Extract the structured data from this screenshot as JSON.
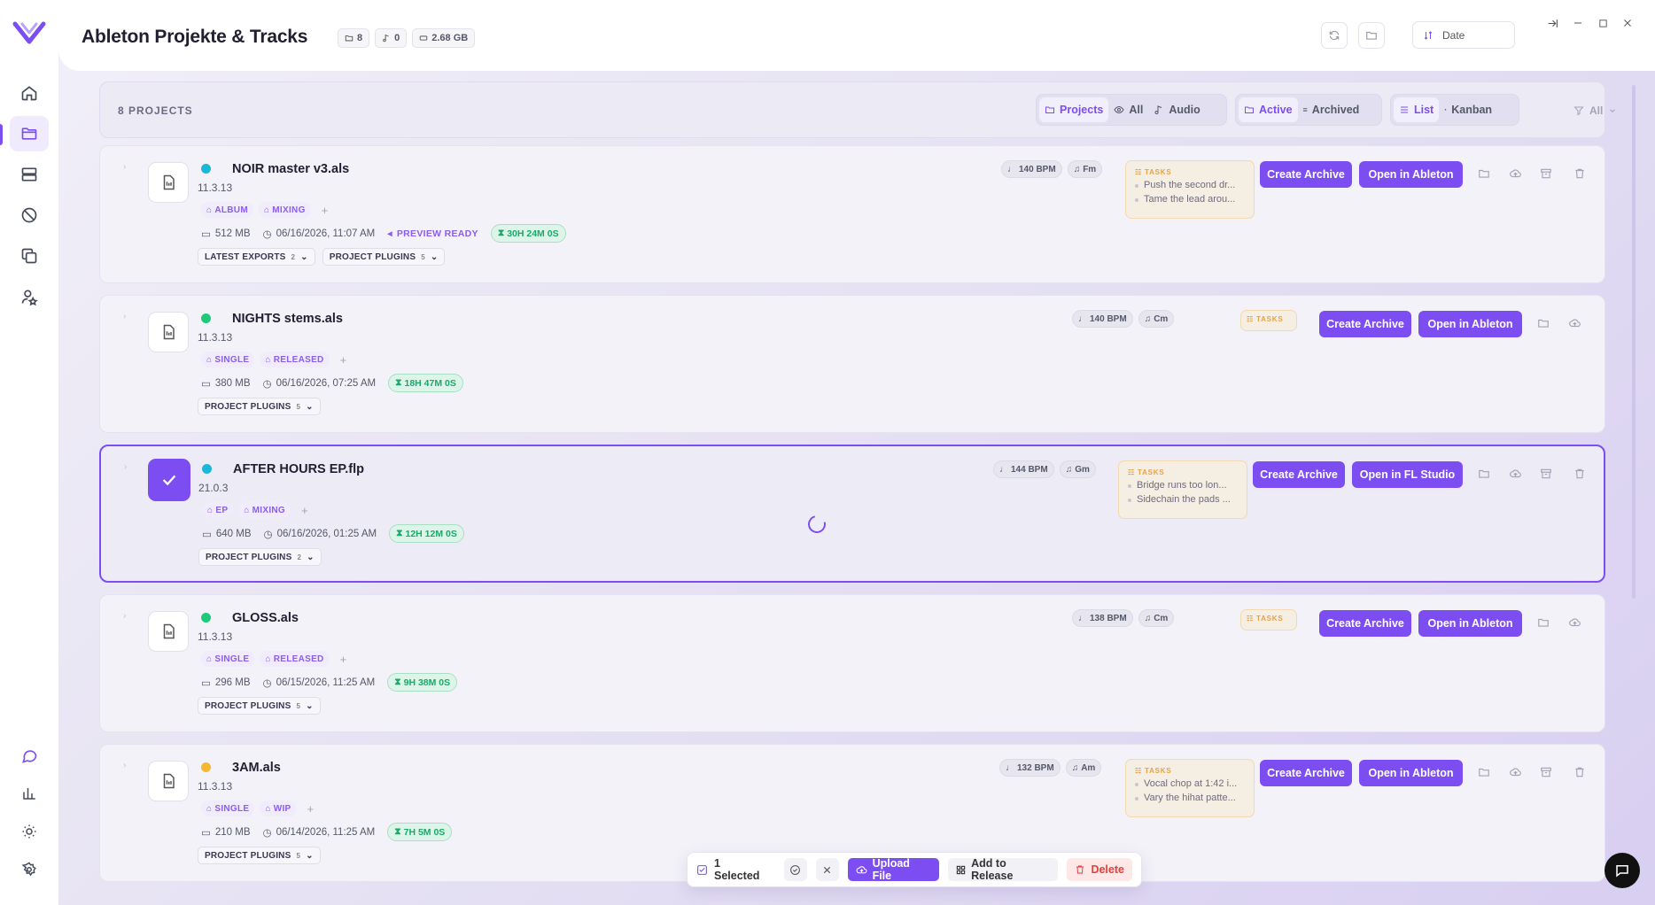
{
  "app": {
    "title": "Ableton Projekte & Tracks"
  },
  "header": {
    "stats": {
      "folders": "8",
      "audio": "0",
      "size": "2.68 GB"
    },
    "sort": "Date"
  },
  "filterbar": {
    "count_label": "8 PROJECTS",
    "type": [
      "Projects",
      "All",
      "Audio"
    ],
    "status": [
      "Active",
      "Archived"
    ],
    "view": [
      "List",
      "Kanban"
    ],
    "filter": "All"
  },
  "common": {
    "tasks_title": "TASKS",
    "create_archive": "Create Archive",
    "plugins_label": "PROJECT PLUGINS",
    "exports_label": "LATEST EXPORTS",
    "preview_ready": "PREVIEW READY"
  },
  "projects": [
    {
      "name": "NOIR master v3.als",
      "version": "11.3.13",
      "status_color": "#1ab7d8",
      "tags": [
        "ALBUM",
        "MIXING"
      ],
      "size": "512 MB",
      "date": "06/16/2026, 11:07 AM",
      "time": "30H 24M 0S",
      "bpm": "140 BPM",
      "key": "Fm",
      "tasks": [
        "Push the second dr...",
        "Tame the lead arou..."
      ],
      "open_label": "Open in Ableton",
      "exports_count": "2",
      "plugins_count": "5"
    },
    {
      "name": "NIGHTS stems.als",
      "version": "11.3.13",
      "status_color": "#1fc97a",
      "tags": [
        "SINGLE",
        "RELEASED"
      ],
      "size": "380 MB",
      "date": "06/16/2026, 07:25 AM",
      "time": "18H 47M 0S",
      "bpm": "140 BPM",
      "key": "Cm",
      "tasks": [],
      "open_label": "Open in Ableton",
      "plugins_count": "5"
    },
    {
      "name": "AFTER HOURS EP.flp",
      "version": "21.0.3",
      "status_color": "#1ab7d8",
      "tags": [
        "EP",
        "MIXING"
      ],
      "size": "640 MB",
      "date": "06/16/2026, 01:25 AM",
      "time": "12H 12M 0S",
      "bpm": "144 BPM",
      "key": "Gm",
      "tasks": [
        "Bridge runs too lon...",
        "Sidechain the pads ..."
      ],
      "open_label": "Open in FL Studio",
      "plugins_count": "2",
      "selected": true
    },
    {
      "name": "GLOSS.als",
      "version": "11.3.13",
      "status_color": "#1fc97a",
      "tags": [
        "SINGLE",
        "RELEASED"
      ],
      "size": "296 MB",
      "date": "06/15/2026, 11:25 AM",
      "time": "9H 38M 0S",
      "bpm": "138 BPM",
      "key": "Cm",
      "tasks": [],
      "open_label": "Open in Ableton",
      "plugins_count": "5"
    },
    {
      "name": "3AM.als",
      "version": "11.3.13",
      "status_color": "#f5b82e",
      "tags": [
        "SINGLE",
        "WIP"
      ],
      "size": "210 MB",
      "date": "06/14/2026, 11:25 AM",
      "time": "7H 5M 0S",
      "bpm": "132 BPM",
      "key": "Am",
      "tasks": [
        "Vocal chop at 1:42 i...",
        "Vary the hihat patte..."
      ],
      "open_label": "Open in Ableton",
      "plugins_count": "5"
    }
  ],
  "selection": {
    "count": "1 Selected",
    "upload": "Upload File",
    "add_release": "Add to Release",
    "delete": "Delete"
  }
}
